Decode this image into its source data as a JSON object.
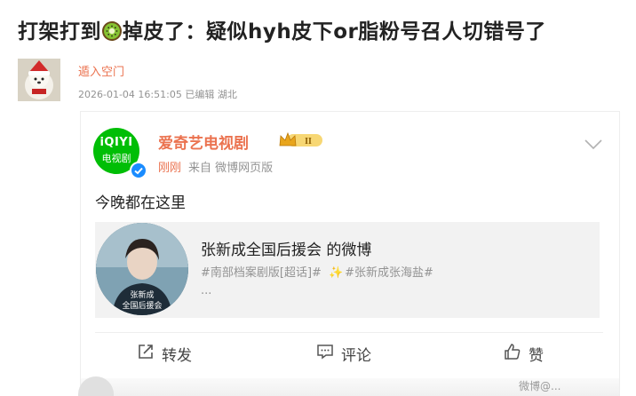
{
  "post": {
    "title_part1": "打架打到",
    "title_part2": "掉皮了：疑似hyh皮下or脂粉号召人切错号了",
    "author": "遁入空门",
    "meta": "2026-01-04 16:51:05 已编辑 湖北"
  },
  "repost": {
    "account_logo_line1": "iQIYI",
    "account_logo_line2": "电视剧",
    "account_name": "爱奇艺电视剧",
    "badge_text": "II",
    "time": "刚刚",
    "source": "来自 微博网页版",
    "content": "今晚都在这里",
    "share_card": {
      "title": "张新成全国后援会 的微博",
      "tag1": "#南部档案剧版[超话]#",
      "tag2": "#张新成张海盐#",
      "more": "...",
      "image_caption_line1": "张新成",
      "image_caption_line2": "全国后援会"
    },
    "actions": {
      "repost": "转发",
      "comment": "评论",
      "like": "赞"
    }
  },
  "watermark": "微博@..."
}
